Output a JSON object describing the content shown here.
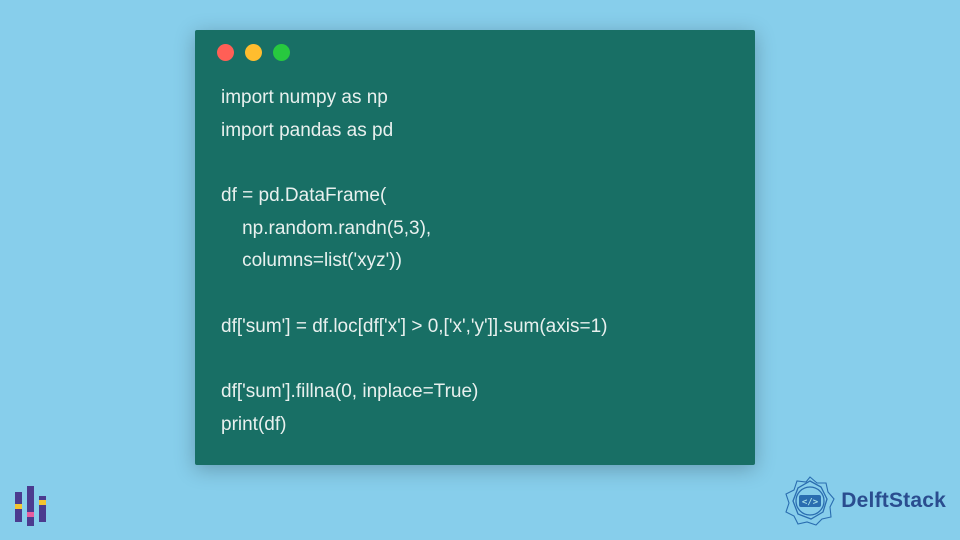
{
  "window": {
    "dots": {
      "red": "#FF5F56",
      "yellow": "#FFBD2E",
      "green": "#27C93F"
    }
  },
  "code": {
    "lines": [
      "import numpy as np",
      "import pandas as pd",
      "",
      "df = pd.DataFrame(",
      "    np.random.randn(5,3),",
      "    columns=list('xyz'))",
      "",
      "df['sum'] = df.loc[df['x'] > 0,['x','y']].sum(axis=1)",
      "",
      "df['sum'].fillna(0, inplace=True)",
      "print(df)"
    ]
  },
  "branding": {
    "name": "DelftStack"
  },
  "colors": {
    "background": "#87CEEB",
    "window_bg": "#186F65",
    "code_text": "#E8F0EE",
    "brand_text": "#2A4D8F",
    "left_logo_primary": "#4B3B8F",
    "left_logo_accent1": "#F4C430",
    "left_logo_accent2": "#E85D9E"
  }
}
